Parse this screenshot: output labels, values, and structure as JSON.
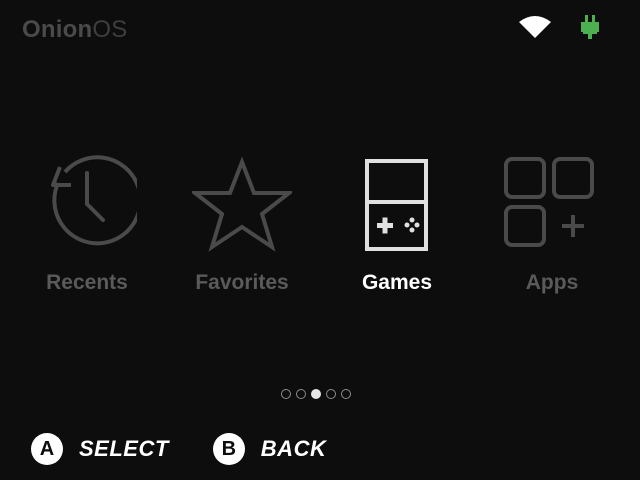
{
  "header": {
    "brand_part1": "Onion",
    "brand_part2": "OS",
    "wifi_icon": "wifi-icon",
    "charging_icon": "charging-plug-icon",
    "charging_color": "#4caf50"
  },
  "menu": {
    "items": [
      {
        "label": "Recents",
        "icon": "clock-history-icon",
        "active": false
      },
      {
        "label": "Favorites",
        "icon": "star-icon",
        "active": false
      },
      {
        "label": "Games",
        "icon": "handheld-console-icon",
        "active": true
      },
      {
        "label": "Apps",
        "icon": "apps-grid-plus-icon",
        "active": false
      }
    ],
    "active_color": "#ffffff",
    "inactive_color": "#5a5a5a"
  },
  "pager": {
    "page_count": 5,
    "current_page": 3
  },
  "legend": {
    "select_key": "A",
    "select_label": "SELECT",
    "back_key": "B",
    "back_label": "BACK"
  }
}
